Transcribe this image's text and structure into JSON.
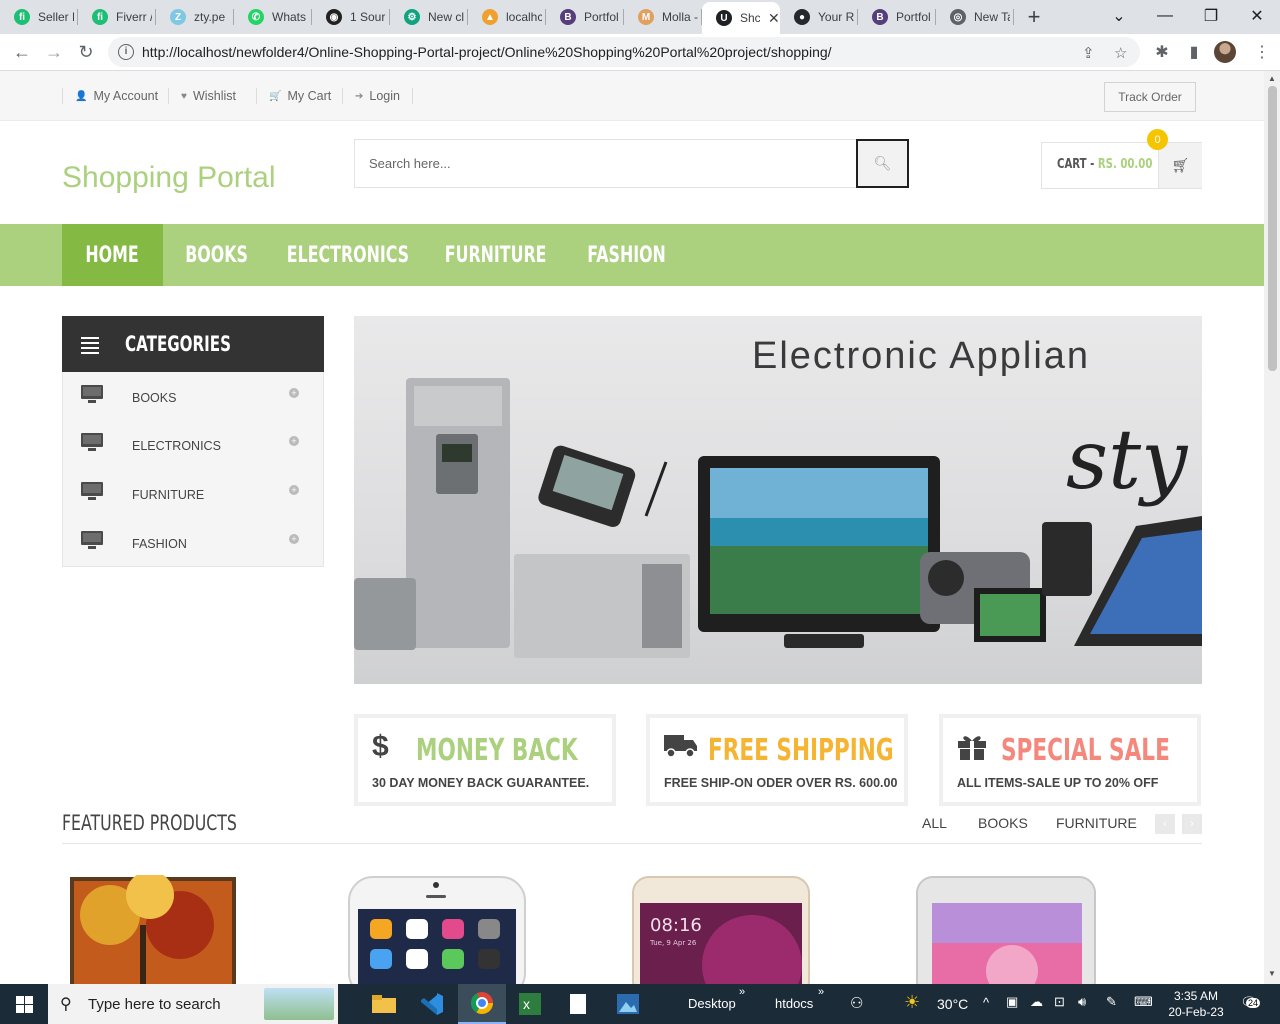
{
  "browser": {
    "tabs": [
      {
        "label": "Seller D",
        "color": "#1dbf73",
        "glyph": "fi"
      },
      {
        "label": "Fiverr /",
        "color": "#1dbf73",
        "glyph": "fi"
      },
      {
        "label": "zty.pe",
        "color": "#7ec8e3",
        "glyph": "Z"
      },
      {
        "label": "Whats",
        "color": "#25d366",
        "glyph": "✆"
      },
      {
        "label": "1 Sour",
        "color": "#222222",
        "glyph": "◉"
      },
      {
        "label": "New cl",
        "color": "#10a37f",
        "glyph": "⚙"
      },
      {
        "label": "localhc",
        "color": "#f0a030",
        "glyph": "▲"
      },
      {
        "label": "Portfol",
        "color": "#563d7c",
        "glyph": "B"
      },
      {
        "label": "Molla -",
        "color": "#e0a060",
        "glyph": "M"
      },
      {
        "label": "Shc",
        "color": "#202124",
        "glyph": "U"
      },
      {
        "label": "Your R",
        "color": "#24292f",
        "glyph": "●"
      },
      {
        "label": "Portfol",
        "color": "#563d7c",
        "glyph": "B"
      },
      {
        "label": "New Ta",
        "color": "#5f6368",
        "glyph": "◎"
      }
    ],
    "url": "http://localhost/newfolder4/Online-Shopping-Portal-project/Online%20Shopping%20Portal%20project/shopping/"
  },
  "topbar": {
    "links": [
      "My Account",
      "Wishlist",
      "My Cart",
      "Login"
    ],
    "track_order": "Track Order"
  },
  "header": {
    "logo": "Shopping Portal",
    "search_placeholder": "Search here...",
    "cart_label": "CART - ",
    "cart_amount": "RS. 00.00",
    "cart_count": "0"
  },
  "nav": {
    "items": [
      "HOME",
      "BOOKS",
      "ELECTRONICS",
      "FURNITURE",
      "FASHION"
    ]
  },
  "sidebar": {
    "title": "CATEGORIES",
    "items": [
      "BOOKS",
      "ELECTRONICS",
      "FURNITURE",
      "FASHION"
    ]
  },
  "banner": {
    "headline": "Electronic Applian",
    "script_text": "sty"
  },
  "info_boxes": [
    {
      "icon": "$",
      "title": "MONEY BACK",
      "subtitle": "30 DAY MONEY BACK GUARANTEE.",
      "color": "#abd07e"
    },
    {
      "icon": "🚚",
      "title": "FREE SHIPPING",
      "subtitle": "FREE SHIP-ON ODER OVER RS. 600.00",
      "color": "#f5b533"
    },
    {
      "icon": "🎁",
      "title": "SPECIAL SALE",
      "subtitle": "ALL ITEMS-SALE UP TO 20% OFF",
      "color": "#f4887c"
    }
  ],
  "featured": {
    "title": "FEATURED PRODUCTS",
    "filters": [
      "ALL",
      "BOOKS",
      "FURNITURE"
    ],
    "phone_time": "08:16",
    "phone_date": "Tue, 9 Apr 26"
  },
  "taskbar": {
    "search_placeholder": "Type here to search",
    "desktop": "Desktop",
    "htdocs": "htdocs",
    "temperature": "30°C",
    "time": "3:35 AM",
    "date": "20-Feb-23",
    "notifications": "24"
  },
  "colors": {
    "accent_green": "#abd07e",
    "nav_active": "#84b943",
    "dark": "#333333"
  }
}
